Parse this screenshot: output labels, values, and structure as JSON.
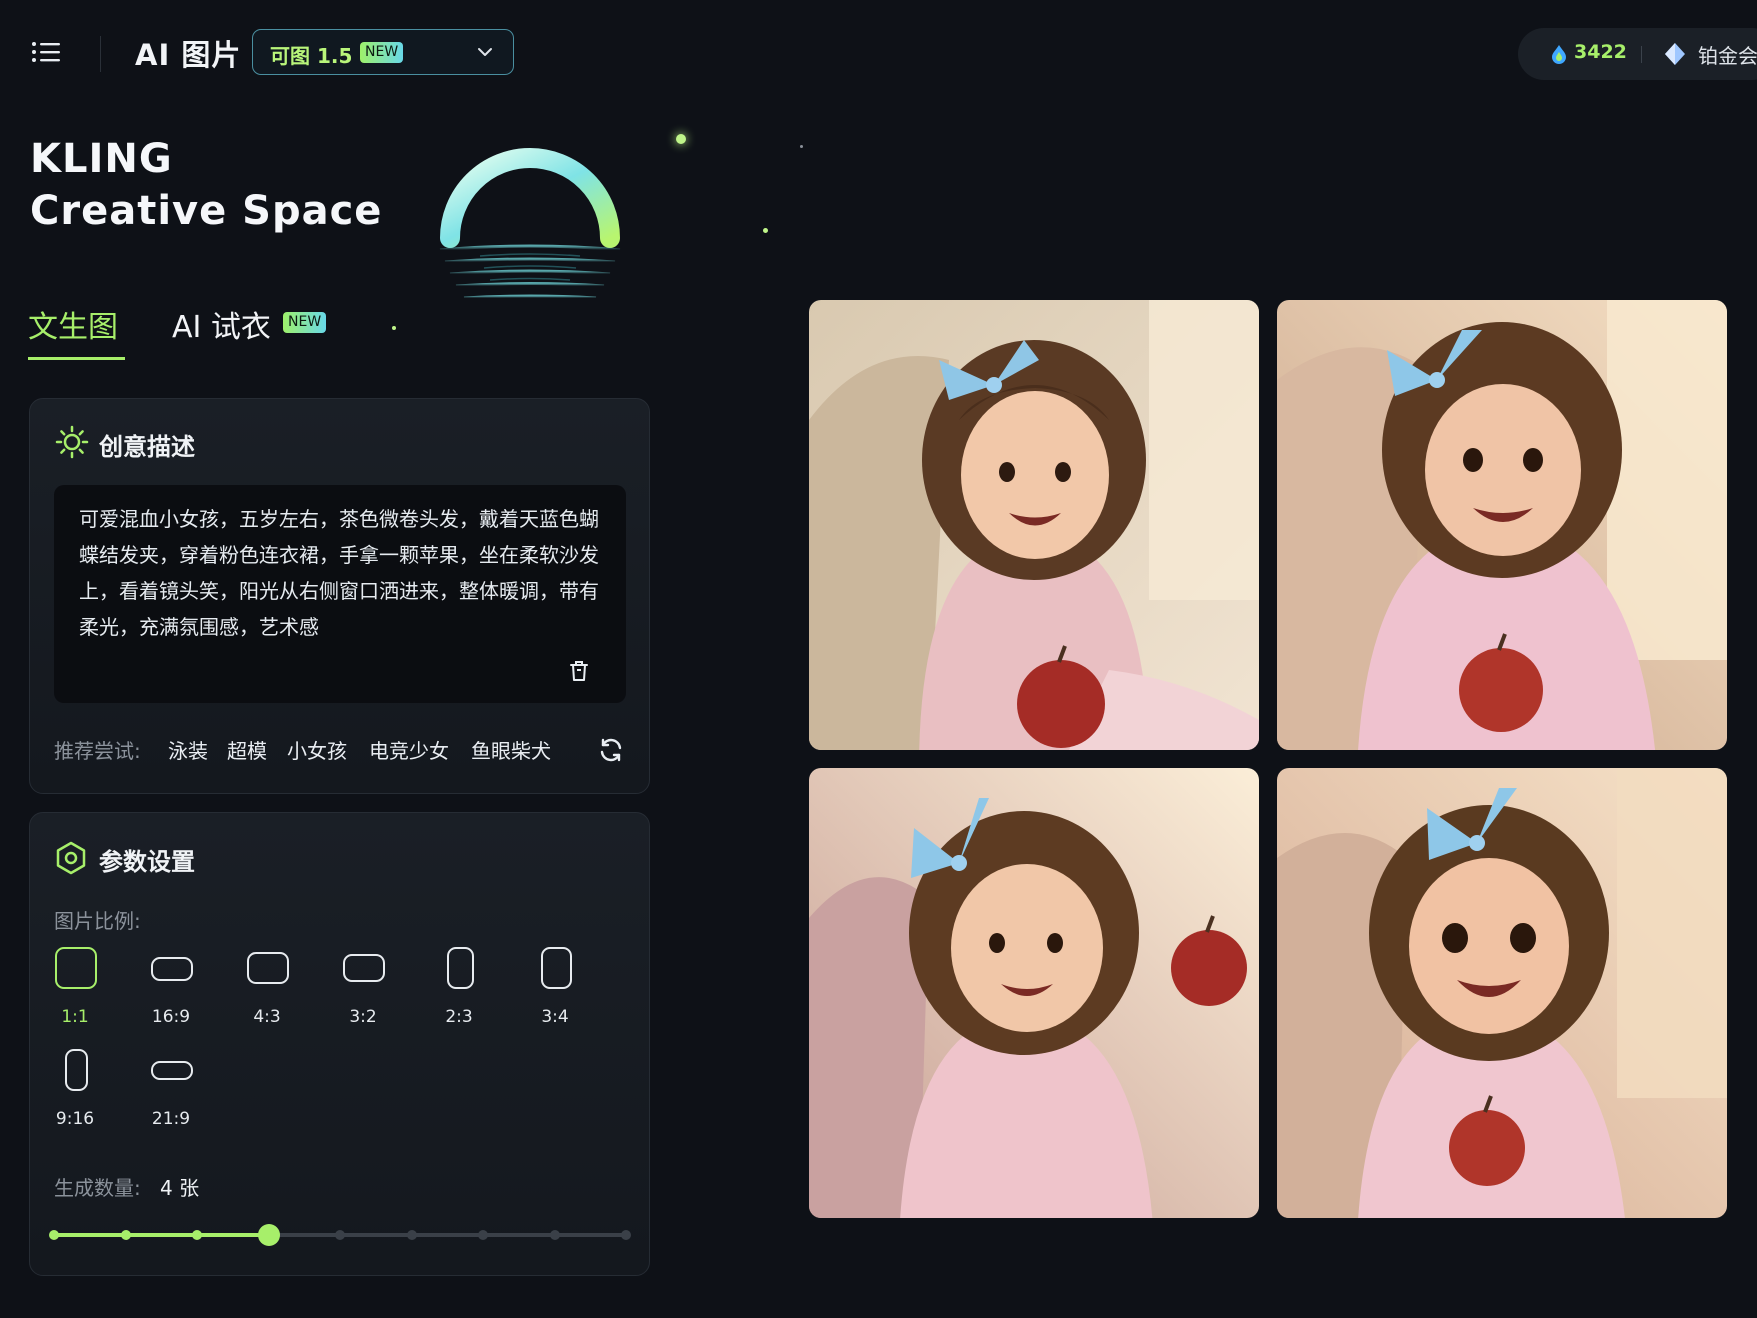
{
  "header": {
    "app_title": "AI 图片",
    "model": {
      "name": "可图 1.5",
      "badge": "NEW"
    },
    "points": "3422",
    "member": "铂金会员"
  },
  "brand": {
    "line1": "KLING",
    "line2": "Creative Space"
  },
  "tabs": [
    {
      "label": "文生图",
      "active": true
    },
    {
      "label": "AI 试衣",
      "badge": "NEW",
      "active": false
    }
  ],
  "prompt_card": {
    "title": "创意描述",
    "text": "可爱混血小女孩，五岁左右，茶色微卷头发，戴着天蓝色蝴蝶结发夹，穿着粉色连衣裙，手拿一颗苹果，坐在柔软沙发上，看着镜头笑，阳光从右侧窗口洒进来，整体暖调，带有柔光，充满氛围感，艺术感",
    "suggest_label": "推荐尝试:",
    "suggestions": [
      "泳装",
      "超模",
      "小女孩",
      "电竞少女",
      "鱼眼柴犬"
    ]
  },
  "params_card": {
    "title": "参数设置",
    "ratio_label": "图片比例:",
    "ratios": [
      "1:1",
      "16:9",
      "4:3",
      "3:2",
      "2:3",
      "3:4",
      "9:16",
      "21:9"
    ],
    "selected_ratio": "1:1",
    "count_label": "生成数量:",
    "count_value": "4 张",
    "count": 4,
    "count_max": 9
  },
  "results": {
    "images": [
      {
        "alt": "image-1"
      },
      {
        "alt": "image-2"
      },
      {
        "alt": "image-3"
      },
      {
        "alt": "image-4"
      }
    ]
  },
  "colors": {
    "accent": "#a7ef6a",
    "background": "#0e1117",
    "card": "#1a1f26"
  }
}
